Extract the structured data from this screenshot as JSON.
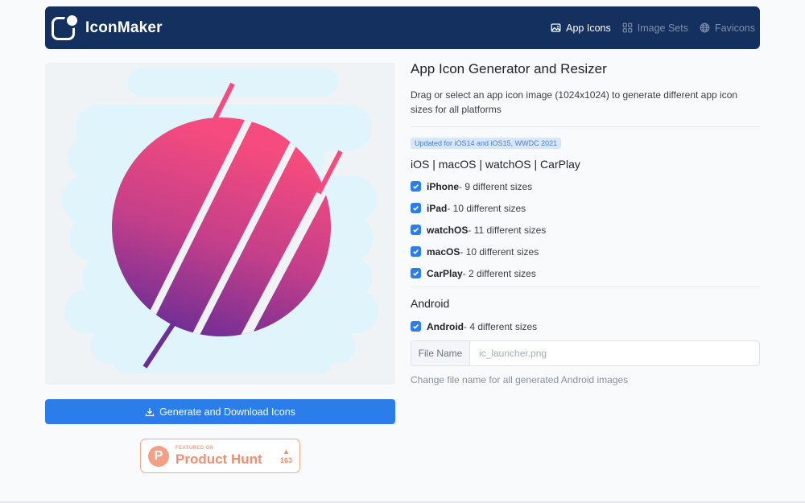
{
  "navbar": {
    "brand": "IconMaker",
    "links": [
      {
        "label": "App Icons",
        "icon": "image-icon",
        "active": true
      },
      {
        "label": "Image Sets",
        "icon": "grid-icon",
        "active": false
      },
      {
        "label": "Favicons",
        "icon": "globe-icon",
        "active": false
      }
    ]
  },
  "preview": {
    "icon": "abstract-circle-artwork"
  },
  "generate_button": {
    "label": "Generate and Download Icons",
    "icon": "download-icon"
  },
  "product_hunt": {
    "featured": "FEATURED ON",
    "name": "Product Hunt",
    "logo_letter": "P",
    "votes": "163"
  },
  "main": {
    "title": "App Icon Generator and Resizer",
    "description": "Drag or select an app icon image (1024x1024) to generate different app icon sizes for all platforms",
    "update_badge": "Updated for iOS14 and iOS15, WWDC 2021",
    "ios_heading": "iOS | macOS | watchOS | CarPlay",
    "ios_options": [
      {
        "name": "iPhone",
        "detail": " - 9 different sizes",
        "checked": true
      },
      {
        "name": "iPad",
        "detail": " - 10 different sizes",
        "checked": true
      },
      {
        "name": "watchOS",
        "detail": " - 11 different sizes",
        "checked": true
      },
      {
        "name": "macOS",
        "detail": " - 10 different sizes",
        "checked": true
      },
      {
        "name": "CarPlay",
        "detail": " - 2 different sizes",
        "checked": true
      }
    ],
    "android_heading": "Android",
    "android_option": {
      "name": "Android",
      "detail": " - 4 different sizes",
      "checked": true
    },
    "file_name": {
      "label": "File Name",
      "value": "",
      "placeholder": "ic_launcher.png"
    },
    "help_text": "Change file name for all generated Android images"
  },
  "colors": {
    "navbar": "#13305e",
    "accent": "#2b7de9",
    "icon_pink": "#f04a80",
    "icon_purple": "#6b2d96",
    "product_hunt": "#f08e70"
  }
}
